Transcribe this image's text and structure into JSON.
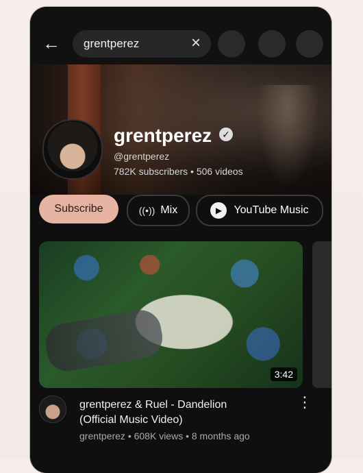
{
  "search": {
    "query": "grentperez"
  },
  "channel": {
    "name": "grentperez",
    "handle": "@grentperez",
    "stats": "782K subscribers • 506 videos"
  },
  "actions": {
    "subscribe_label": "Subscribe",
    "mix_label": "Mix",
    "ytmusic_label": "YouTube Music"
  },
  "video": {
    "duration": "3:42",
    "title_line1": "grentperez & Ruel - Dandelion",
    "title_line2": "(Official Music Video)",
    "meta": "grentperez • 608K views • 8 months ago"
  },
  "icons": {
    "back": "back-arrow-icon",
    "clear": "close-icon",
    "verified": "verified-icon",
    "mix": "radio-waves-icon",
    "ytmusic": "youtube-music-icon",
    "more": "more-vertical-icon"
  },
  "colors": {
    "background": "#0f0f0f",
    "subscribe": "#e7b3a2",
    "text": "#f1f1f1",
    "muted": "#aaaaaa"
  }
}
